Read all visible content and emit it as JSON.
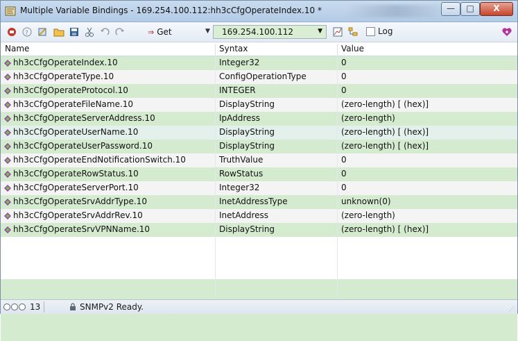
{
  "window": {
    "title": "Multiple Variable Bindings - 169.254.100.112:hh3cCfgOperateIndex.10 *",
    "title_blurred_segment": "",
    "minimize_label": "—",
    "maximize_label": "□",
    "close_label": "X"
  },
  "toolbar": {
    "get_label": "Get",
    "get_arrow": "⇒",
    "address": "169.254.100.112",
    "log_label": "Log",
    "log_checked": false
  },
  "table": {
    "columns": [
      "Name",
      "Syntax",
      "Value"
    ],
    "rows": [
      {
        "name": "hh3cCfgOperateIndex.10",
        "syntax": "Integer32",
        "value": "0"
      },
      {
        "name": "hh3cCfgOperateType.10",
        "syntax": "ConfigOperationType",
        "value": "0"
      },
      {
        "name": "hh3cCfgOperateProtocol.10",
        "syntax": "INTEGER",
        "value": "0"
      },
      {
        "name": "hh3cCfgOperateFileName.10",
        "syntax": "DisplayString",
        "value": "(zero-length)  [ (hex)]"
      },
      {
        "name": "hh3cCfgOperateServerAddress.10",
        "syntax": "IpAddress",
        "value": "(zero-length)"
      },
      {
        "name": "hh3cCfgOperateUserName.10",
        "syntax": "DisplayString",
        "value": "(zero-length)  [ (hex)]"
      },
      {
        "name": "hh3cCfgOperateUserPassword.10",
        "syntax": "DisplayString",
        "value": "(zero-length)  [ (hex)]"
      },
      {
        "name": "hh3cCfgOperateEndNotificationSwitch.10",
        "syntax": "TruthValue",
        "value": "0"
      },
      {
        "name": "hh3cCfgOperateRowStatus.10",
        "syntax": "RowStatus",
        "value": "0"
      },
      {
        "name": "hh3cCfgOperateServerPort.10",
        "syntax": "Integer32",
        "value": "0"
      },
      {
        "name": "hh3cCfgOperateSrvAddrType.10",
        "syntax": "InetAddressType",
        "value": "unknown(0)"
      },
      {
        "name": "hh3cCfgOperateSrvAddrRev.10",
        "syntax": "InetAddress",
        "value": "(zero-length)"
      },
      {
        "name": "hh3cCfgOperateSrvVPNName.10",
        "syntax": "DisplayString",
        "value": "(zero-length)  [ (hex)]"
      }
    ]
  },
  "status": {
    "count": "13",
    "text": "SNMPv2 Ready."
  },
  "colors": {
    "row_green": "#d5ebcf",
    "row_light": "#f4f4f4",
    "row_selected": "#e3f0ec",
    "address_bg": "#d9eed3"
  },
  "icons": {
    "app": "mib-browser-icon",
    "leaf": "leaf-node-icon",
    "status_lock": "lock-icon"
  }
}
